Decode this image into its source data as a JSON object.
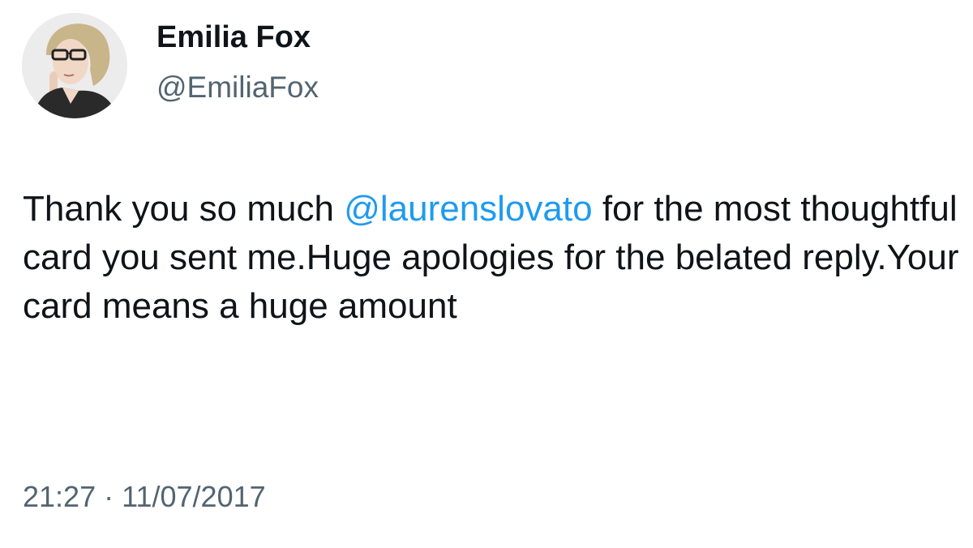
{
  "author": {
    "display_name": "Emilia Fox",
    "handle": "@EmiliaFox"
  },
  "tweet": {
    "text_before_mention": "Thank you so much ",
    "mention": "@laurenslovato",
    "text_after_mention": " for the most thoughtful card you sent me.Huge apologies for the belated reply.Your card means a huge amount",
    "time": "21:27",
    "separator": "·",
    "date": "11/07/2017"
  },
  "colors": {
    "mention": "#1d9bf0",
    "secondary_text": "#536471",
    "primary_text": "#0f1419"
  },
  "icons": {
    "avatar": "profile-photo"
  }
}
